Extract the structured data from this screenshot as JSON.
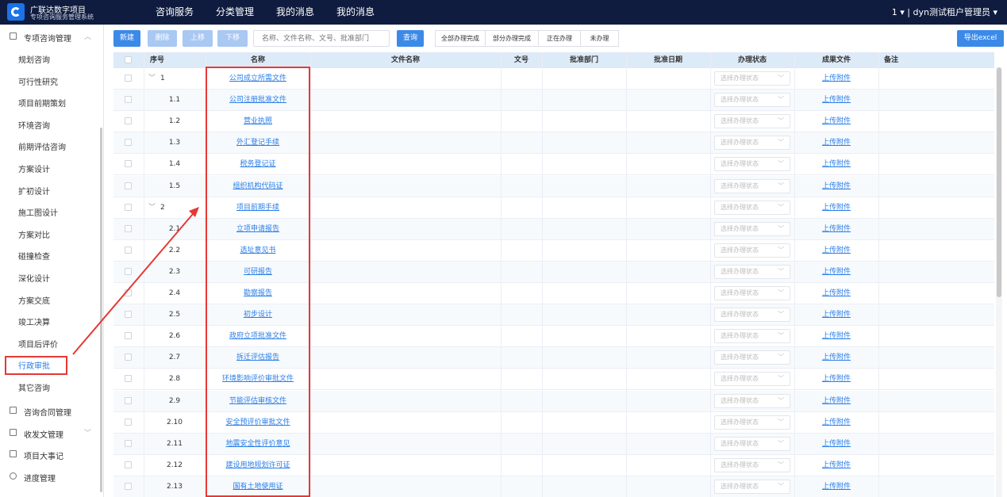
{
  "app": {
    "title": "广联达数字项目",
    "subtitle": "专项咨询服务管理系统"
  },
  "top_nav": [
    "咨询服务",
    "分类管理",
    "我的消息",
    "我的消息"
  ],
  "user": {
    "count": "1",
    "name": "dyn测试租户管理员"
  },
  "sidebar": {
    "group1": "专项咨询管理",
    "items": [
      "规划咨询",
      "可行性研究",
      "项目前期策划",
      "环境咨询",
      "前期评估咨询",
      "方案设计",
      "扩初设计",
      "施工图设计",
      "方案对比",
      "碰撞检查",
      "深化设计",
      "方案交底",
      "竣工决算",
      "项目后评价",
      "行政审批",
      "其它咨询"
    ],
    "active_index": 14,
    "groups_bottom": [
      "咨询合同管理",
      "收发文管理",
      "项目大事记",
      "进度管理"
    ]
  },
  "toolbar": {
    "new": "新建",
    "delete": "删除",
    "up": "上移",
    "down": "下移",
    "search_placeholder": "名称、文件名称、文号、批准部门",
    "query": "查询",
    "filters": [
      "全部办理完成",
      "部分办理完成",
      "正在办理",
      "未办理"
    ],
    "export": "导出excel"
  },
  "table": {
    "headers": {
      "seq": "序号",
      "name": "名称",
      "file_name": "文件名称",
      "doc_no": "文号",
      "dept": "批准部门",
      "date": "批准日期",
      "status": "办理状态",
      "result": "成果文件",
      "remark": "备注"
    },
    "status_placeholder": "选择办理状态",
    "upload_label": "上传附件",
    "rows": [
      {
        "seq": "1",
        "name": "公司成立所需文件",
        "group": true
      },
      {
        "seq": "1.1",
        "name": "公司注册批准文件"
      },
      {
        "seq": "1.2",
        "name": "营业执照"
      },
      {
        "seq": "1.3",
        "name": "外汇登记手续"
      },
      {
        "seq": "1.4",
        "name": "税务登记证"
      },
      {
        "seq": "1.5",
        "name": "组织机构代码证"
      },
      {
        "seq": "2",
        "name": "项目前期手续",
        "group": true
      },
      {
        "seq": "2.1",
        "name": "立项申请报告"
      },
      {
        "seq": "2.2",
        "name": "选址意见书"
      },
      {
        "seq": "2.3",
        "name": "可研报告"
      },
      {
        "seq": "2.4",
        "name": "勘察报告"
      },
      {
        "seq": "2.5",
        "name": "初步设计"
      },
      {
        "seq": "2.6",
        "name": "政府立项批准文件"
      },
      {
        "seq": "2.7",
        "name": "拆迁评估报告"
      },
      {
        "seq": "2.8",
        "name": "环境影响评价审批文件"
      },
      {
        "seq": "2.9",
        "name": "节能评估审核文件"
      },
      {
        "seq": "2.10",
        "name": "安全预评价审批文件"
      },
      {
        "seq": "2.11",
        "name": "地震安全性评价意见"
      },
      {
        "seq": "2.12",
        "name": "建设用地规划许可证"
      },
      {
        "seq": "2.13",
        "name": "国有土地使用证"
      }
    ]
  }
}
